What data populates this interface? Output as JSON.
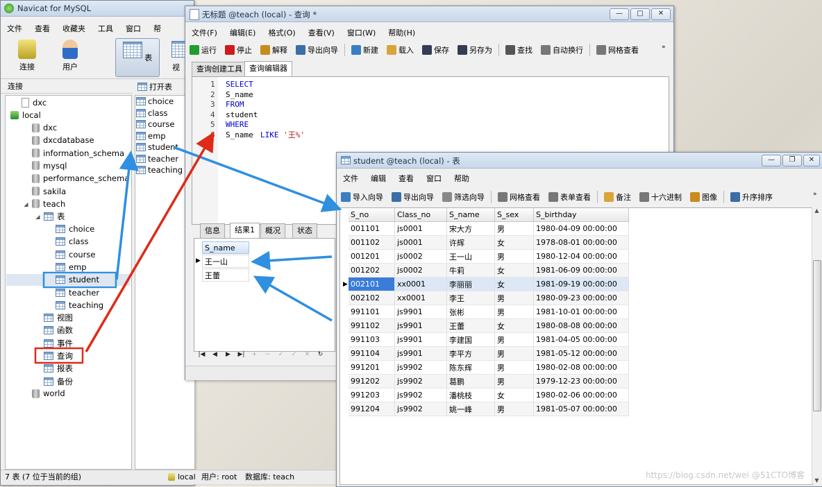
{
  "main_window": {
    "title": "Navicat for MySQL",
    "menu": [
      "文件",
      "查看",
      "收藏夹",
      "工具",
      "窗口",
      "帮"
    ],
    "toolbar": [
      {
        "label": "连接",
        "icon": "connection-icon"
      },
      {
        "label": "用户",
        "icon": "user-icon"
      },
      {
        "label": "表",
        "icon": "table-icon"
      },
      {
        "label": "视",
        "icon": "view-icon"
      }
    ],
    "sidebar_header": "连接",
    "tree": {
      "dxc_top": "dxc",
      "local": "local",
      "databases": [
        "dxc",
        "dxcdatabase",
        "information_schema",
        "mysql",
        "performance_schema",
        "sakila",
        "teach"
      ],
      "teach_folder": "表",
      "tables": [
        "choice",
        "class",
        "course",
        "emp",
        "student",
        "teacher",
        "teaching"
      ],
      "other_nodes": [
        "视图",
        "函数",
        "事件",
        "查询",
        "报表",
        "备份"
      ],
      "world": "world"
    },
    "object_toolbar": {
      "open": "打开表"
    },
    "object_list": [
      "choice",
      "class",
      "course",
      "emp",
      "student",
      "teacher",
      "teaching"
    ],
    "status": {
      "left": "7 表 (7 位于当前的组)",
      "conn": "local",
      "user": "用户: root",
      "db": "数据库: teach"
    }
  },
  "query_window": {
    "title": "无标题 @teach (local) - 查询 *",
    "menu": [
      "文件(F)",
      "编辑(E)",
      "格式(O)",
      "查看(V)",
      "窗口(W)",
      "帮助(H)"
    ],
    "toolbar": [
      {
        "label": "运行",
        "icon": "run-icon",
        "color": "#1f9e2c"
      },
      {
        "label": "停止",
        "icon": "stop-icon",
        "color": "#d01a1a"
      },
      {
        "label": "解释",
        "icon": "explain-icon",
        "color": "#c98b1a"
      },
      {
        "label": "导出向导",
        "icon": "export-icon",
        "color": "#3a6ea5"
      },
      {
        "label": "新建",
        "icon": "new-icon",
        "color": "#3a7ec2"
      },
      {
        "label": "载入",
        "icon": "load-icon",
        "color": "#d9a43a"
      },
      {
        "label": "保存",
        "icon": "save-icon",
        "color": "#333b55"
      },
      {
        "label": "另存为",
        "icon": "save-as-icon",
        "color": "#333b55"
      },
      {
        "label": "查找",
        "icon": "find-icon",
        "color": "#555"
      },
      {
        "label": "自动换行",
        "icon": "wrap-icon",
        "color": "#777"
      },
      {
        "label": "网格查看",
        "icon": "grid-view-icon",
        "color": "#777"
      }
    ],
    "tabs": [
      "查询创建工具",
      "查询编辑器"
    ],
    "code_lines": [
      {
        "n": "1",
        "text": "SELECT",
        "type": "kw"
      },
      {
        "n": "2",
        "text": "S_name",
        "type": "plain"
      },
      {
        "n": "3",
        "text": "FROM",
        "type": "kw"
      },
      {
        "n": "4",
        "text": "student",
        "type": "plain"
      },
      {
        "n": "5",
        "text": "WHERE",
        "type": "kw"
      },
      {
        "n": "6",
        "text": "S_name ",
        "type": "plain",
        "kw": "LIKE",
        "str": "'王%'"
      }
    ],
    "result_tabs": [
      "信息",
      "结果1",
      "概况",
      "状态"
    ],
    "result_header": "S_name",
    "result_rows": [
      "王一山",
      "王蕾"
    ],
    "nav_buttons": [
      "|◀",
      "◀",
      "▶",
      "▶|",
      "+",
      "−",
      "✓",
      "✓",
      "✕",
      "↻"
    ]
  },
  "student_window": {
    "title": "student @teach (local) - 表",
    "menu": [
      "文件",
      "编辑",
      "查看",
      "窗口",
      "帮助"
    ],
    "toolbar": [
      {
        "label": "导入向导",
        "icon": "import-icon"
      },
      {
        "label": "导出向导",
        "icon": "export-icon"
      },
      {
        "label": "筛选向导",
        "icon": "filter-icon"
      },
      {
        "label": "网格查看",
        "icon": "grid-view-icon"
      },
      {
        "label": "表单查看",
        "icon": "form-view-icon"
      },
      {
        "label": "备注",
        "icon": "memo-icon"
      },
      {
        "label": "十六进制",
        "icon": "hex-icon"
      },
      {
        "label": "图像",
        "icon": "image-icon"
      },
      {
        "label": "升序排序",
        "icon": "sort-asc-icon"
      }
    ],
    "columns": [
      "S_no",
      "Class_no",
      "S_name",
      "S_sex",
      "S_birthday"
    ],
    "rows": [
      [
        "001101",
        "js0001",
        "宋大方",
        "男",
        "1980-04-09 00:00:00"
      ],
      [
        "001102",
        "js0001",
        "许辉",
        "女",
        "1978-08-01 00:00:00"
      ],
      [
        "001201",
        "js0002",
        "王一山",
        "男",
        "1980-12-04 00:00:00"
      ],
      [
        "001202",
        "js0002",
        "牛莉",
        "女",
        "1981-06-09 00:00:00"
      ],
      [
        "002101",
        "xx0001",
        "李丽丽",
        "女",
        "1981-09-19 00:00:00"
      ],
      [
        "002102",
        "xx0001",
        "李王",
        "男",
        "1980-09-23 00:00:00"
      ],
      [
        "991101",
        "js9901",
        "张彬",
        "男",
        "1981-10-01 00:00:00"
      ],
      [
        "991102",
        "js9901",
        "王蕾",
        "女",
        "1980-08-08 00:00:00"
      ],
      [
        "991103",
        "js9901",
        "李建国",
        "男",
        "1981-04-05 00:00:00"
      ],
      [
        "991104",
        "js9901",
        "李平方",
        "男",
        "1981-05-12 00:00:00"
      ],
      [
        "991201",
        "js9902",
        "陈东辉",
        "男",
        "1980-02-08 00:00:00"
      ],
      [
        "991202",
        "js9902",
        "葛鹏",
        "男",
        "1979-12-23 00:00:00"
      ],
      [
        "991203",
        "js9902",
        "潘桃枝",
        "女",
        "1980-02-06 00:00:00"
      ],
      [
        "991204",
        "js9902",
        "姚一峰",
        "男",
        "1981-05-07 00:00:00"
      ]
    ]
  },
  "watermark": "https://blog.csdn.net/wei @51CTO博客",
  "colors": {
    "arrow_blue": "#2f8fe0",
    "arrow_red": "#e02a1a",
    "highlight_blue": "#2f8fe0",
    "highlight_red": "#e02a1a"
  }
}
